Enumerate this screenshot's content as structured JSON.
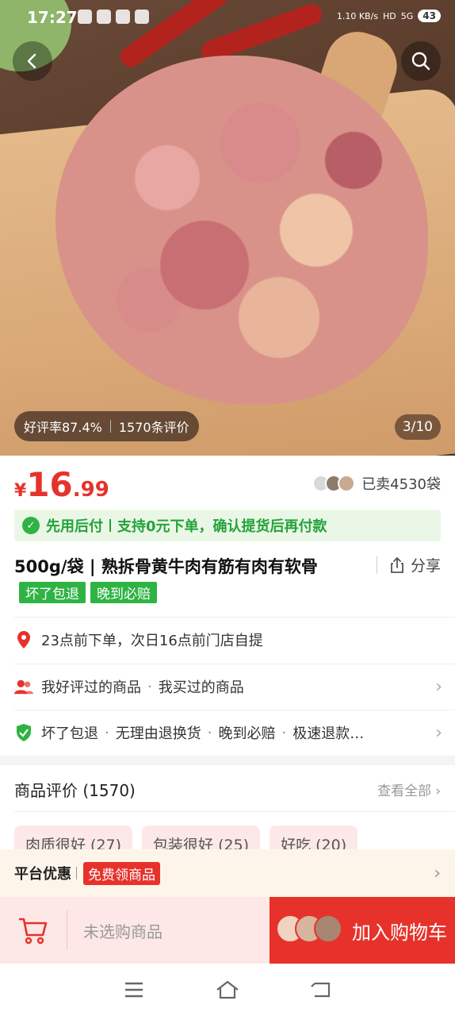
{
  "status": {
    "time": "17:27",
    "net_speed": "1.10 KB/s",
    "hd": "HD",
    "signal": "5G",
    "battery": "43"
  },
  "gallery": {
    "rating_text": "好评率87.4%",
    "review_count_text": "1570条评价",
    "pager": "3/10"
  },
  "price": {
    "currency": "¥",
    "integer": "16",
    "decimal": ".99",
    "color": "#e7322b"
  },
  "sold_text": "已卖4530袋",
  "banner": {
    "part1": "先用后付",
    "part2": "支持0元下单，确认提货后再付款",
    "color": "#24a33a"
  },
  "product": {
    "title": "500g/袋 | 熟拆骨黄牛肉有筋有肉有软骨",
    "share_label": "分享",
    "tags": [
      "坏了包退",
      "晚到必赔"
    ]
  },
  "rows": {
    "pickup": "23点前下单，次日16点前门店自提",
    "reviewed": "我好评过的商品",
    "purchased": "我买过的商品",
    "guarantees": [
      "坏了包退",
      "无理由退换货",
      "晚到必赔",
      "极速退款…"
    ]
  },
  "reviews": {
    "title": "商品评价 (1570)",
    "see_all": "查看全部",
    "chips": [
      "肉质很好 (27)",
      "包装很好 (25)",
      "好吃 (20)"
    ]
  },
  "promo": {
    "label": "平台优惠",
    "badge": "免费领商品"
  },
  "cart": {
    "unselected": "未选购商品",
    "add_to_cart": "加入购物车"
  },
  "icons": {
    "back": "back-arrow-icon",
    "search": "search-icon",
    "share": "share-icon",
    "location": "location-pin-icon",
    "users": "users-icon",
    "shield": "shield-check-icon",
    "cart": "cart-icon"
  }
}
